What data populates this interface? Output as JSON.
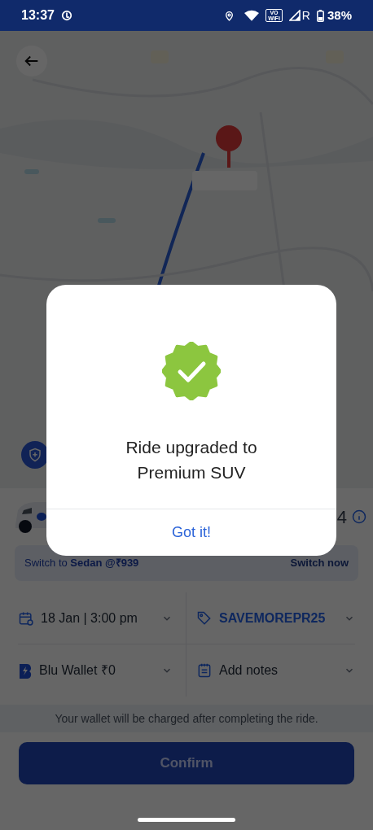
{
  "status_bar": {
    "time": "13:37",
    "vowifi_top": "VO",
    "vowifi_bottom": "WiFi",
    "network": "R",
    "battery": "38%"
  },
  "ride": {
    "price_fragment": "4"
  },
  "switch_offer": {
    "text": "Switch to **Sedan @₹939**",
    "action": "Switch now"
  },
  "options": [
    {
      "kind": "schedule",
      "label": "18 Jan | 3:00 pm"
    },
    {
      "kind": "coupon",
      "label": "SAVEMOREPR25"
    },
    {
      "kind": "wallet",
      "label": "Blu Wallet ₹0"
    },
    {
      "kind": "notes",
      "label": "Add notes"
    }
  ],
  "wallet_note": "Your wallet will be charged after completing the ride.",
  "confirm_button": "Confirm",
  "dialog": {
    "title": "Ride upgraded to Premium SUV",
    "button": "Got it!"
  }
}
